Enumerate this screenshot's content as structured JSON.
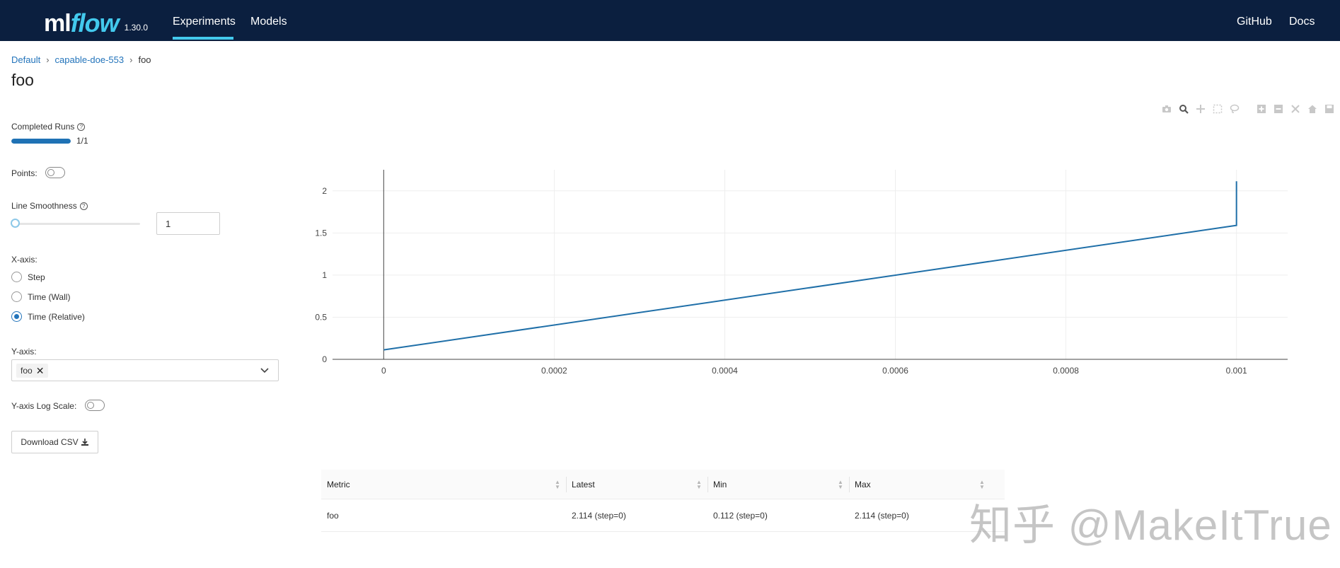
{
  "header": {
    "logo_ml": "ml",
    "logo_flow": "flow",
    "version": "1.30.0",
    "nav": {
      "experiments": "Experiments",
      "models": "Models",
      "github": "GitHub",
      "docs": "Docs"
    }
  },
  "breadcrumb": {
    "items": [
      "Default",
      "capable-doe-553",
      "foo"
    ],
    "separator": "›"
  },
  "page_title": "foo",
  "controls": {
    "completed_runs_label": "Completed Runs",
    "completed_runs_text": "1/1",
    "completed_runs_fraction": 1,
    "points_label": "Points:",
    "points_on": false,
    "line_smoothness_label": "Line Smoothness",
    "line_smoothness_value": "1",
    "xaxis_label": "X-axis:",
    "xaxis_options": [
      "Step",
      "Time (Wall)",
      "Time (Relative)"
    ],
    "xaxis_selected": "Time (Relative)",
    "yaxis_label": "Y-axis:",
    "yaxis_selected": "foo",
    "yaxis_log_label": "Y-axis Log Scale:",
    "yaxis_log_on": false,
    "download_label": "Download CSV"
  },
  "chart_data": {
    "type": "line",
    "title": "",
    "xlabel": "",
    "ylabel": "",
    "xlim": [
      -6e-05,
      0.00106
    ],
    "ylim": [
      0,
      2.25
    ],
    "x_ticks": [
      0,
      0.0002,
      0.0004,
      0.0006,
      0.0008,
      0.001
    ],
    "x_tick_labels": [
      "0",
      "0.0002",
      "0.0004",
      "0.0006",
      "0.0008",
      "0.001"
    ],
    "y_ticks": [
      0,
      0.5,
      1,
      1.5,
      2
    ],
    "y_tick_labels": [
      "0",
      "0.5",
      "1",
      "1.5",
      "2"
    ],
    "grid": true,
    "series": [
      {
        "x": [
          0,
          0.001,
          0.001
        ],
        "y": [
          0.112,
          1.59,
          2.114
        ],
        "color": "#1f6fa8"
      }
    ]
  },
  "metrics_table": {
    "columns": [
      "Metric",
      "Latest",
      "Min",
      "Max"
    ],
    "rows": [
      [
        "foo",
        "2.114 (step=0)",
        "0.112 (step=0)",
        "2.114 (step=0)"
      ]
    ]
  },
  "watermark": "知乎 @MakeItTrue",
  "colors": {
    "header_bg": "#0b1f3f",
    "accent": "#43c9ed",
    "link": "#2374bb",
    "line": "#1f6fa8"
  }
}
